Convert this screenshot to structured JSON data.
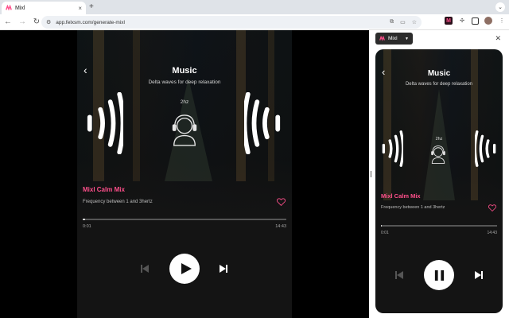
{
  "browser": {
    "tab_title": "Mixl",
    "tab_close": "×",
    "new_tab": "+",
    "url": "app.felxsm.com/generate-mixl",
    "chrome_menu": "⌄"
  },
  "icons": {
    "back": "‹",
    "close": "✕",
    "caret": "▼"
  },
  "player": {
    "title": "Music",
    "subtitle": "Delta waves for deep relaxation",
    "frequency": "2hz",
    "mix_name": "Mixl Calm Mix",
    "mix_description": "Frequency between 1 and 3hertz",
    "time_elapsed": "0:01",
    "time_total": "14:43",
    "progress_fraction": 0.01,
    "state": "paused"
  },
  "side_panel": {
    "tab_label": "Mixl",
    "title": "Music",
    "subtitle": "Delta waves for deep relaxation",
    "frequency": "2hz",
    "mix_name": "Mixl Calm Mix",
    "mix_description": "Frequency between 1 and 3hertz",
    "time_elapsed": "0:01",
    "time_total": "14:43",
    "progress_fraction": 0.01,
    "state": "playing"
  },
  "colors": {
    "accent": "#ff4f8b",
    "panel_bg": "#141414",
    "text": "#ffffff"
  }
}
